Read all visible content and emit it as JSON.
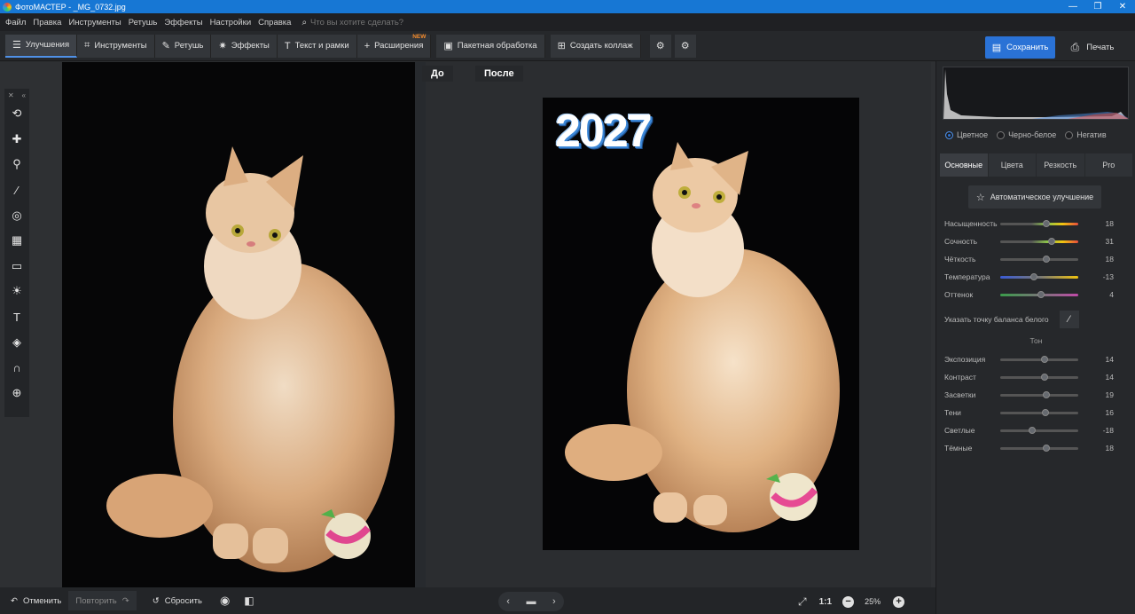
{
  "app": {
    "title": "ФотоМАСТЕР - _MG_0732.jpg"
  },
  "window_controls": {
    "minimize": "—",
    "restore": "❐",
    "close": "✕"
  },
  "menu": {
    "items": [
      "Файл",
      "Правка",
      "Инструменты",
      "Ретушь",
      "Эффекты",
      "Настройки",
      "Справка"
    ],
    "search_placeholder": "Что вы хотите сделать?"
  },
  "toolbar": {
    "tabs": [
      {
        "label": "Улучшения",
        "icon": "sliders-icon"
      },
      {
        "label": "Инструменты",
        "icon": "crop-icon"
      },
      {
        "label": "Ретушь",
        "icon": "brush-icon"
      },
      {
        "label": "Эффекты",
        "icon": "wand-icon"
      },
      {
        "label": "Текст и рамки",
        "icon": "text-icon"
      },
      {
        "label": "Расширения",
        "icon": "plus-icon",
        "badge": "NEW"
      }
    ],
    "batch_label": "Пакетная обработка",
    "collage_label": "Создать коллаж",
    "save_label": "Сохранить",
    "print_label": "Печать"
  },
  "view": {
    "before_label": "До",
    "after_label": "После",
    "overlay_text": "2027"
  },
  "bottom": {
    "undo_label": "Отменить",
    "redo_label": "Повторить",
    "reset_label": "Сбросить",
    "ratio_label": "1:1",
    "zoom": "25%"
  },
  "panel": {
    "modes": [
      "Цветное",
      "Черно-белое",
      "Негатив"
    ],
    "selected_mode": "Цветное",
    "tabs": [
      "Основные",
      "Цвета",
      "Резкость",
      "Pro"
    ],
    "active_tab": "Основные",
    "auto_label": "Автоматическое улучшение",
    "sliders": [
      {
        "label": "Насыщенность",
        "value": "18",
        "level": 0.59
      },
      {
        "label": "Сочность",
        "value": "31",
        "level": 0.655
      },
      {
        "label": "Чёткость",
        "value": "18",
        "level": 0.59
      },
      {
        "label": "Температура",
        "value": "-13",
        "level": 0.435
      },
      {
        "label": "Оттенок",
        "value": "4",
        "level": 0.52
      }
    ],
    "wb_label": "Указать точку баланса белого",
    "tone_title": "Тон",
    "tone_sliders": [
      {
        "label": "Экспозиция",
        "value": "14",
        "level": 0.57
      },
      {
        "label": "Контраст",
        "value": "14",
        "level": 0.57
      },
      {
        "label": "Засветки",
        "value": "19",
        "level": 0.595
      },
      {
        "label": "Тени",
        "value": "16",
        "level": 0.58
      },
      {
        "label": "Светлые",
        "value": "-18",
        "level": 0.41
      },
      {
        "label": "Тёмные",
        "value": "18",
        "level": 0.59
      }
    ]
  },
  "colors": {
    "accent": "#2a72d6",
    "titlebar": "#1777d4",
    "badge": "#f28a2b"
  }
}
